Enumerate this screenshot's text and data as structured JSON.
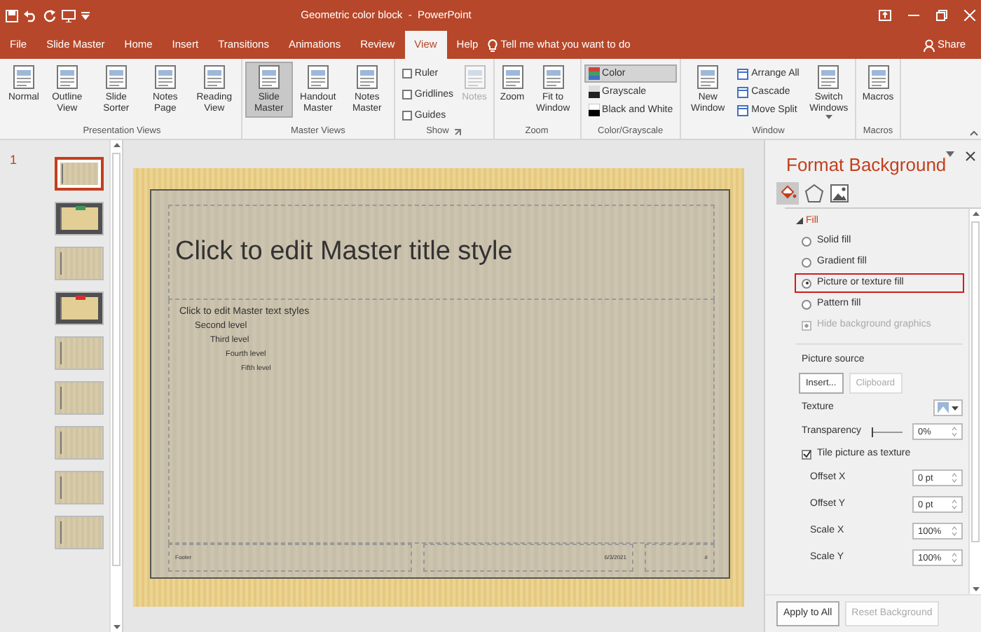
{
  "window": {
    "title": "Geometric color block  -  PowerPoint"
  },
  "tabs": [
    {
      "label": "File",
      "selected": false
    },
    {
      "label": "Slide Master",
      "selected": false
    },
    {
      "label": "Home",
      "selected": false
    },
    {
      "label": "Insert",
      "selected": false
    },
    {
      "label": "Transitions",
      "selected": false
    },
    {
      "label": "Animations",
      "selected": false
    },
    {
      "label": "Review",
      "selected": false
    },
    {
      "label": "View",
      "selected": true
    },
    {
      "label": "Help",
      "selected": false
    }
  ],
  "tell_me": "Tell me what you want to do",
  "share": "Share",
  "ribbon": [
    {
      "label": "Presentation Views",
      "items": [
        {
          "kind": "big",
          "label": "Normal",
          "selected": false
        },
        {
          "kind": "big",
          "label": "Outline View",
          "selected": false
        },
        {
          "kind": "big",
          "label": "Slide Sorter",
          "selected": false
        },
        {
          "kind": "big",
          "label": "Notes Page",
          "selected": false
        },
        {
          "kind": "big",
          "label": "Reading View",
          "selected": false
        }
      ]
    },
    {
      "label": "Master Views",
      "items": [
        {
          "kind": "big",
          "label": "Slide Master",
          "selected": true
        },
        {
          "kind": "big",
          "label": "Handout Master",
          "selected": false
        },
        {
          "kind": "big",
          "label": "Notes Master",
          "selected": false
        }
      ]
    },
    {
      "label": "Show",
      "launcher": true,
      "items": [
        {
          "kind": "checks",
          "options": [
            {
              "label": "Ruler",
              "checked": false
            },
            {
              "label": "Gridlines",
              "checked": false
            },
            {
              "label": "Guides",
              "checked": false
            }
          ]
        },
        {
          "kind": "big",
          "label": "Notes",
          "selected": false,
          "disabled": true
        }
      ]
    },
    {
      "label": "Zoom",
      "items": [
        {
          "kind": "big",
          "label": "Zoom",
          "selected": false
        },
        {
          "kind": "big",
          "label": "Fit to Window",
          "selected": false
        }
      ]
    },
    {
      "label": "Color/Grayscale",
      "items": [
        {
          "kind": "swatches",
          "options": [
            {
              "label": "Color",
              "selected": true
            },
            {
              "label": "Grayscale",
              "selected": false
            },
            {
              "label": "Black and White",
              "selected": false
            }
          ]
        }
      ]
    },
    {
      "label": "Window",
      "items": [
        {
          "kind": "big",
          "label": "New Window",
          "selected": false
        },
        {
          "kind": "smalls",
          "options": [
            {
              "label": "Arrange All"
            },
            {
              "label": "Cascade"
            },
            {
              "label": "Move Split"
            }
          ]
        },
        {
          "kind": "big",
          "label": "Switch Windows",
          "selected": false,
          "dropdown": true
        }
      ]
    },
    {
      "label": "Macros",
      "items": [
        {
          "kind": "big",
          "label": "Macros",
          "selected": false
        }
      ]
    }
  ],
  "thumbnails": {
    "number": "1",
    "slides": [
      {
        "kind": "light",
        "selected": true
      },
      {
        "kind": "dark",
        "selected": false,
        "color": "#3a9a5a"
      },
      {
        "kind": "light",
        "selected": false
      },
      {
        "kind": "dark",
        "selected": false,
        "color": "#d83030"
      },
      {
        "kind": "light",
        "selected": false
      },
      {
        "kind": "light",
        "selected": false
      },
      {
        "kind": "light",
        "selected": false
      },
      {
        "kind": "light",
        "selected": false
      },
      {
        "kind": "light",
        "selected": false
      }
    ]
  },
  "slide": {
    "title": "Click to edit Master title style",
    "bullets": [
      {
        "text": "Click to edit Master text styles",
        "children": [
          {
            "text": "Second level",
            "children": [
              {
                "text": "Third level",
                "children": [
                  {
                    "text": "Fourth level",
                    "children": [
                      {
                        "text": "Fifth level"
                      }
                    ]
                  }
                ]
              }
            ]
          }
        ]
      }
    ],
    "footer": "Footer",
    "date": "6/3/2021",
    "number": "#"
  },
  "format_pane": {
    "title": "Format Background",
    "section": "Fill",
    "expanded": true,
    "fill_options": [
      {
        "label": "Solid fill",
        "selected": false,
        "highlighted": false
      },
      {
        "label": "Gradient fill",
        "selected": false,
        "highlighted": false
      },
      {
        "label": "Picture or texture fill",
        "selected": true,
        "highlighted": true
      },
      {
        "label": "Pattern fill",
        "selected": false,
        "highlighted": false
      }
    ],
    "hide_graphics": {
      "label": "Hide background graphics",
      "checked": true,
      "disabled": true
    },
    "picture_source": "Picture source",
    "source_buttons": [
      {
        "label": "Insert...",
        "disabled": false
      },
      {
        "label": "Clipboard",
        "disabled": true
      }
    ],
    "texture": "Texture",
    "transparency": {
      "label": "Transparency",
      "level": 0,
      "value": "0%"
    },
    "tile": {
      "label": "Tile picture as texture",
      "checked": true
    },
    "fields": [
      {
        "label": "Offset X",
        "value": "0 pt"
      },
      {
        "label": "Offset Y",
        "value": "0 pt"
      },
      {
        "label": "Scale X",
        "value": "100%"
      },
      {
        "label": "Scale Y",
        "value": "100%"
      }
    ],
    "buttons": [
      {
        "label": "Apply to All",
        "disabled": false
      },
      {
        "label": "Reset Background",
        "disabled": true
      }
    ]
  }
}
